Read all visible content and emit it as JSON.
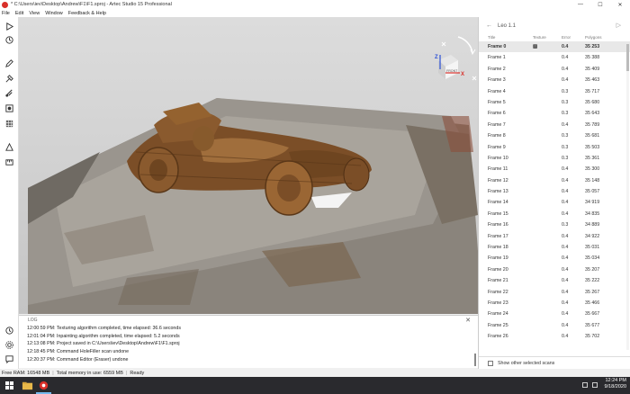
{
  "window": {
    "title": "* C:\\Users\\iev\\Desktop\\Andrew\\F1\\F1.sproj - Artec Studio 15 Professional",
    "controls": [
      "—",
      "☐",
      "✕"
    ]
  },
  "menu": {
    "items": [
      "File",
      "Edit",
      "View",
      "Window",
      "Feedback & Help"
    ]
  },
  "left_toolbar": {
    "tools": [
      {
        "name": "play-icon"
      },
      {
        "name": "autopilot-icon"
      },
      {
        "name": "pencil-icon"
      },
      {
        "name": "tools-icon"
      },
      {
        "name": "fix-icon"
      },
      {
        "name": "register-icon"
      },
      {
        "name": "texture-icon"
      },
      {
        "name": "measure-icon"
      },
      {
        "name": "ruler-icon"
      },
      {
        "name": "history-icon"
      },
      {
        "name": "settings-icon"
      },
      {
        "name": "chat-icon"
      }
    ]
  },
  "viewport": {
    "navcube": {
      "face_label": "FRONT",
      "axis_z": "Z",
      "axis_x": "X"
    }
  },
  "log": {
    "header": "LOG",
    "lines": [
      "12:00:59 PM: Texturing algorithm completed, time elapsed: 36.6 seconds",
      "12:01:04 PM: Inpainting algorithm completed, time elapsed: 5.2 seconds",
      "12:13:08 PM: Project saved in C:\\Users\\iev\\Desktop\\Andrew\\F1\\F1.sproj",
      "12:18:45 PM: Command HoleFiller scan undone",
      "12:20:37 PM: Command Editor (Eraser) undone"
    ]
  },
  "status": {
    "free_ram": "Free RAM: 16548 MB",
    "total_memory": "Total memory in use: 6559 MB",
    "state": "Ready"
  },
  "right_panel": {
    "back_label": "←",
    "title": "Leo 1.1",
    "columns": {
      "title": "Title",
      "texture": "Texture",
      "error": "Error",
      "polygons": "Polygons"
    },
    "frames": [
      {
        "name": "Frame 0",
        "texture": "▧",
        "error": "0.4",
        "polygons": "35 253"
      },
      {
        "name": "Frame 1",
        "texture": "",
        "error": "0.4",
        "polygons": "35 388"
      },
      {
        "name": "Frame 2",
        "texture": "",
        "error": "0.4",
        "polygons": "35 409"
      },
      {
        "name": "Frame 3",
        "texture": "",
        "error": "0.4",
        "polygons": "35 463"
      },
      {
        "name": "Frame 4",
        "texture": "",
        "error": "0.3",
        "polygons": "35 717"
      },
      {
        "name": "Frame 5",
        "texture": "",
        "error": "0.3",
        "polygons": "35 680"
      },
      {
        "name": "Frame 6",
        "texture": "",
        "error": "0.3",
        "polygons": "35 643"
      },
      {
        "name": "Frame 7",
        "texture": "",
        "error": "0.4",
        "polygons": "35 789"
      },
      {
        "name": "Frame 8",
        "texture": "",
        "error": "0.3",
        "polygons": "35 681"
      },
      {
        "name": "Frame 9",
        "texture": "",
        "error": "0.3",
        "polygons": "35 503"
      },
      {
        "name": "Frame 10",
        "texture": "",
        "error": "0.3",
        "polygons": "35 361"
      },
      {
        "name": "Frame 11",
        "texture": "",
        "error": "0.4",
        "polygons": "35 300"
      },
      {
        "name": "Frame 12",
        "texture": "",
        "error": "0.4",
        "polygons": "35 148"
      },
      {
        "name": "Frame 13",
        "texture": "",
        "error": "0.4",
        "polygons": "35 057"
      },
      {
        "name": "Frame 14",
        "texture": "",
        "error": "0.4",
        "polygons": "34 919"
      },
      {
        "name": "Frame 15",
        "texture": "",
        "error": "0.4",
        "polygons": "34 835"
      },
      {
        "name": "Frame 16",
        "texture": "",
        "error": "0.3",
        "polygons": "34 889"
      },
      {
        "name": "Frame 17",
        "texture": "",
        "error": "0.4",
        "polygons": "34 922"
      },
      {
        "name": "Frame 18",
        "texture": "",
        "error": "0.4",
        "polygons": "35 031"
      },
      {
        "name": "Frame 19",
        "texture": "",
        "error": "0.4",
        "polygons": "35 034"
      },
      {
        "name": "Frame 20",
        "texture": "",
        "error": "0.4",
        "polygons": "35 207"
      },
      {
        "name": "Frame 21",
        "texture": "",
        "error": "0.4",
        "polygons": "35 222"
      },
      {
        "name": "Frame 22",
        "texture": "",
        "error": "0.4",
        "polygons": "35 267"
      },
      {
        "name": "Frame 23",
        "texture": "",
        "error": "0.4",
        "polygons": "35 466"
      },
      {
        "name": "Frame 24",
        "texture": "",
        "error": "0.4",
        "polygons": "35 667"
      },
      {
        "name": "Frame 25",
        "texture": "",
        "error": "0.4",
        "polygons": "35 677"
      },
      {
        "name": "Frame 26",
        "texture": "",
        "error": "0.4",
        "polygons": "35 702"
      }
    ],
    "footer_checkbox_label": "Show other selected scans"
  },
  "taskbar": {
    "time": "12:24 PM",
    "date": "9/18/2020"
  },
  "colors": {
    "accent": "#d9302a",
    "wood": "#8a5a2e",
    "taskbar": "#2a2a2e"
  }
}
